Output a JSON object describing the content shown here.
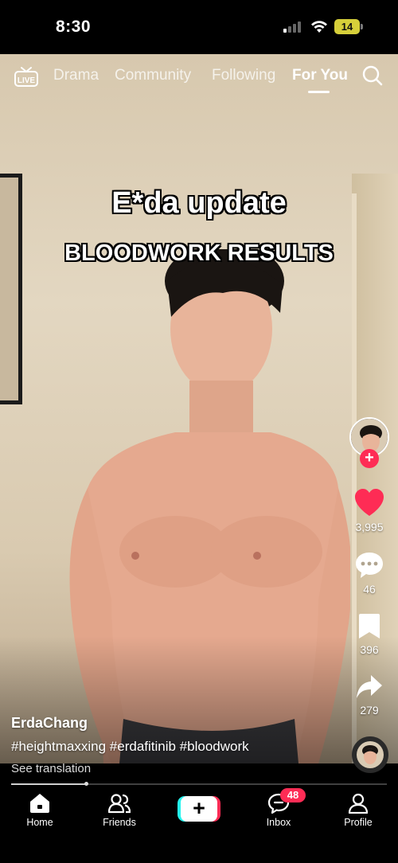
{
  "status_bar": {
    "time": "8:30",
    "battery": "14"
  },
  "top_nav": {
    "live_label": "LIVE",
    "tabs": [
      {
        "label": "Drama",
        "active": false
      },
      {
        "label": "Community",
        "active": false
      },
      {
        "label": "Following",
        "active": false
      },
      {
        "label": "For You",
        "active": true
      }
    ]
  },
  "video": {
    "overlay_title": "E*da update",
    "overlay_subtitle": "BLOODWORK RESULTS"
  },
  "actions": {
    "likes": "3,995",
    "comments": "46",
    "saves": "396",
    "shares": "279"
  },
  "post": {
    "username": "ErdaChang",
    "hashtags": "#heightmaxxing #erdafitinib #bloodwork",
    "see_translation": "See translation",
    "progress": 0.2
  },
  "bottom_nav": {
    "home": "Home",
    "friends": "Friends",
    "create_symbol": "+",
    "inbox": "Inbox",
    "inbox_badge": "48",
    "profile": "Profile"
  },
  "colors": {
    "accent": "#fe2c55",
    "cyan": "#25f4ee",
    "battery": "#d6cf3a"
  }
}
